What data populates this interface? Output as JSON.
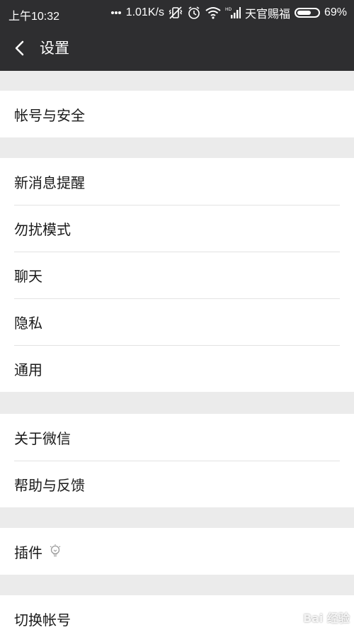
{
  "status_bar": {
    "time": "上午10:32",
    "speed": "1.01K/s",
    "carrier": "天官赐福",
    "battery": "69%",
    "battery_level": 0.69
  },
  "header": {
    "title": "设置"
  },
  "groups": [
    {
      "items": [
        "帐号与安全"
      ]
    },
    {
      "items": [
        "新消息提醒",
        "勿扰模式",
        "聊天",
        "隐私",
        "通用"
      ]
    },
    {
      "items": [
        "关于微信",
        "帮助与反馈"
      ]
    },
    {
      "items": [
        "插件"
      ]
    },
    {
      "items": [
        "切换帐号"
      ]
    }
  ],
  "watermark": "Bai 经验",
  "icons": [
    "back-icon",
    "more-dots-icon",
    "vibrate-icon",
    "alarm-icon",
    "wifi-icon",
    "signal-icon",
    "battery-icon",
    "lightbulb-icon"
  ]
}
